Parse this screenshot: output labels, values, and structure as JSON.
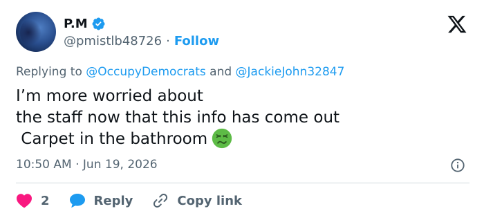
{
  "author": {
    "display_name": "P.M",
    "handle": "@pmistlb48726",
    "separator": "·",
    "follow_label": "Follow"
  },
  "reply": {
    "prefix": "Replying to",
    "mention_1": "@OccupyDemocrats",
    "conjunction": "and",
    "mention_2": "@JackieJohn32847"
  },
  "body": {
    "lines": [
      "I’m more worried about",
      "the staff now that this info has come out",
      " Carpet in the bathroom"
    ],
    "emoji": "nauseated-face-icon"
  },
  "meta": {
    "time": "10:50 AM",
    "separator": "·",
    "date": "Jun 19, 2026"
  },
  "actions": {
    "like_count": "2",
    "reply_label": "Reply",
    "copy_label": "Copy link"
  },
  "colors": {
    "accent": "#1d9bf0",
    "like": "#f91880",
    "muted": "#536471",
    "text": "#0f1419",
    "emoji": "#5dbb46"
  }
}
